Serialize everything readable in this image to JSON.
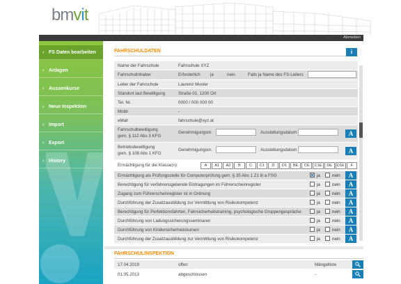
{
  "logo": {
    "text_a": "bm",
    "text_v": "v",
    "text_i": "i",
    "text_t": "t"
  },
  "topbar": {
    "logout": "Abmelden"
  },
  "sidebar": {
    "items": [
      {
        "label": "FS Daten bearbeiten",
        "active": true
      },
      {
        "label": "Anlagen"
      },
      {
        "label": "Aussenkurse"
      },
      {
        "label": "Neue Inspektion"
      },
      {
        "label": "Import"
      },
      {
        "label": "Export"
      },
      {
        "label": "History"
      }
    ]
  },
  "fahrschuldaten": {
    "title": "FAHRSCHULDATEN",
    "info_btn": "i",
    "name_label": "Name der Fahrschule",
    "name_value": "Fahrschule XYZ",
    "inhaber_label": "Fahrschulinhaber",
    "inhaber_erforderlich": "Erforderlich",
    "inhaber_ja": "ja",
    "inhaber_nein": "nein",
    "inhaber_falls": "Falls ja Name des FS-Leiters",
    "leiter_label": "Leiter der Fahrschule",
    "leiter_value": "Laurenz Muster",
    "standort_label": "Standort laut Bewilligung",
    "standort_value": "Straße 01, 1200 Ort",
    "tel_label": "Tel. Nr.",
    "tel_value": "0000 / 000 000 00",
    "mobil_label": "Mobil",
    "mobil_value": "-",
    "email_label": "eMail",
    "email_value": "fahrschule@xyz.at",
    "bew1_label_a": "Fahrschulbewilligung",
    "bew1_label_b": "gem. § 112 Abs 3 KFG",
    "bew2_label_a": "Betriebsbewilligung",
    "bew2_label_b": "gem. § 108 Abs 1 KFG",
    "genehmigung": "Genehmigungsnr.",
    "ausstellung": "Ausstellungsdatum",
    "a_btn": "A",
    "klassen_label": "Ermächtigung für die Klasse(n)",
    "klassen": [
      "A",
      "A1",
      "A2",
      "B",
      "C",
      "C1",
      "D",
      "D1",
      "BE",
      "CE",
      "C1E",
      "DE",
      "D1E",
      "F"
    ]
  },
  "ermaechtigungen": [
    {
      "label": "Ermächtigung als Prüfungsstelle für Computerprüfung gem. § 35 Abs 1 Z1 lit a FSG",
      "ja": true
    },
    {
      "label": "Berechtigung für verfahrensgebende Eintragungen im Führerscheinregister",
      "ja": false
    },
    {
      "label": "Zugang zum Führerscheinregister ist in Ordnung",
      "ja": false
    },
    {
      "label": "Durchführung der Zusatzausbildung zur Vermittlung von Risikokompetenz",
      "ja": false
    },
    {
      "label": "Berechtigung für Perfektionsfahrten, Fahrsicherheitstraining, psychologische Gruppengespräche",
      "ja": false
    },
    {
      "label": "Durchführung von Ladungssicherungsseminaren",
      "ja": false
    },
    {
      "label": "Durchführung von Kindersicherheitskursen",
      "ja": false
    },
    {
      "label": "Durchführung der Zusatzausbildung zur Vermittlung von Risikokompetenz",
      "ja": false
    }
  ],
  "ja_label": "ja",
  "nein_label": "nein",
  "inspektion": {
    "title": "FAHRSCHULINSPEKTION",
    "rows": [
      {
        "date": "17.04.2019",
        "status": "offen",
        "extra": "Mängelliste"
      },
      {
        "date": "01.05.2013",
        "status": "abgeschlossen",
        "extra": "-"
      }
    ]
  }
}
